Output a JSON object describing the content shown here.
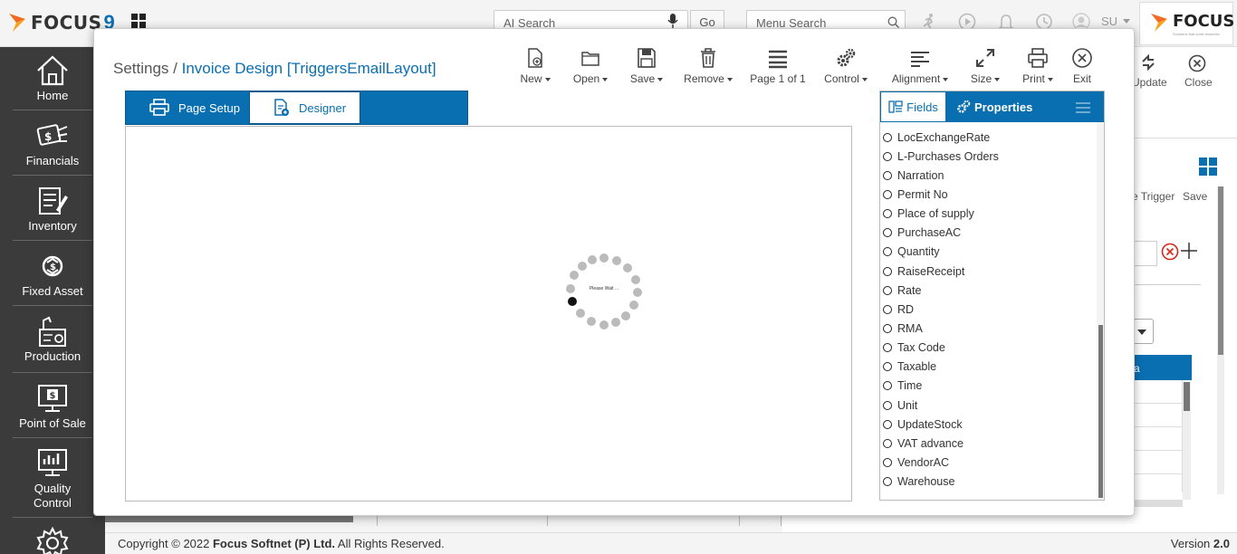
{
  "header": {
    "logo_text": "FOCUS",
    "logo_number": "9",
    "ai_search_placeholder": "AI Search",
    "go_label": "Go",
    "menu_search_placeholder": "Menu Search",
    "user_initials": "SU",
    "brand_text": "FOCUS",
    "brand_tagline": "Solutions that scale business"
  },
  "sidebar": {
    "items": [
      {
        "label": "Home",
        "icon": "home-icon"
      },
      {
        "label": "Financials",
        "icon": "financials-icon"
      },
      {
        "label": "Inventory",
        "icon": "inventory-icon"
      },
      {
        "label": "Fixed Asset",
        "icon": "fixed-asset-icon"
      },
      {
        "label": "Production",
        "icon": "production-icon"
      },
      {
        "label": "Point of Sale",
        "icon": "point-of-sale-icon"
      },
      {
        "label": "Quality Control",
        "icon": "quality-control-icon"
      },
      {
        "label": "",
        "icon": "settings-icon"
      }
    ]
  },
  "background": {
    "update_label": "Update",
    "close_label": "Close",
    "trigger_label": "e Trigger",
    "save_label": "Save",
    "grid_header": "a"
  },
  "modal": {
    "breadcrumb_root": "Settings /",
    "breadcrumb_current": "Invoice Design [TriggersEmailLayout]",
    "toolbar": [
      {
        "label": "New",
        "icon": "new-file-icon",
        "dropdown": true
      },
      {
        "label": "Open",
        "icon": "folder-icon",
        "dropdown": true
      },
      {
        "label": "Save",
        "icon": "save-icon",
        "dropdown": true
      },
      {
        "label": "Remove",
        "icon": "trash-icon",
        "dropdown": true
      },
      {
        "label": "Page 1 of 1",
        "icon": "page-icon",
        "dropdown": false
      },
      {
        "label": "Control",
        "icon": "gears-icon",
        "dropdown": true
      },
      {
        "label": "Alignment",
        "icon": "align-icon",
        "dropdown": true
      },
      {
        "label": "Size",
        "icon": "resize-icon",
        "dropdown": true
      },
      {
        "label": "Print",
        "icon": "print-icon",
        "dropdown": true
      },
      {
        "label": "Exit",
        "icon": "exit-icon",
        "dropdown": false
      }
    ],
    "tabs": {
      "page_setup": "Page Setup",
      "designer": "Designer"
    },
    "loading_text": "Please Wait ...",
    "panel": {
      "fields_tab": "Fields",
      "properties_tab": "Properties",
      "fields": [
        "LocExchangeRate",
        "L-Purchases Orders",
        "Narration",
        "Permit No",
        "Place of supply",
        "PurchaseAC",
        "Quantity",
        "RaiseReceipt",
        "Rate",
        "RD",
        "RMA",
        "Tax Code",
        "Taxable",
        "Time",
        "Unit",
        "UpdateStock",
        "VAT advance",
        "VendorAC",
        "Warehouse"
      ]
    }
  },
  "footer": {
    "copyright_prefix": "Copyright © 2022 ",
    "copyright_company": "Focus Softnet (P) Ltd.",
    "copyright_suffix": " All Rights Reserved.",
    "version_label": "Version",
    "version_number": "2.0"
  },
  "colors": {
    "accent": "#0a6fb0",
    "sidebar": "#3b3b3b",
    "logo_orange": "#f26b21"
  }
}
